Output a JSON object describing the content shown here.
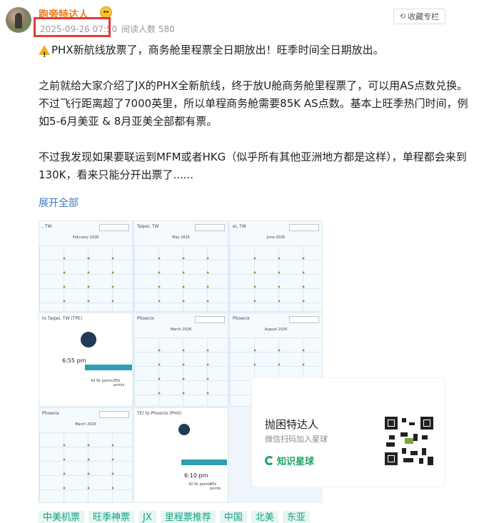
{
  "header": {
    "author": "跑旁特达人",
    "date": "2025-09-26 07:50",
    "views_label": "阅读人数",
    "views": "580",
    "collect_label": "收藏专栏"
  },
  "article": {
    "p1": "PHX新航线放票了，商务舱里程票全日期放出！旺季时间全日期放出。",
    "p2": "之前就给大家介绍了JX的PHX全新航线，终于放U舱商务舱里程票了，可以用AS点数兑换。不过飞行距离超了7000英里，所以单程商务舱需要85K AS点数。基本上旺季热门时间，例如5-6月美亚 & 8月亚美全部都有票。",
    "p3": "不过我发现如果要联运到MFM或者HKG（似乎所有其他亚洲地方都是这样），单程都会来到130K，看来只能分开出票了......",
    "expand": "展开全部"
  },
  "collage": {
    "panel1_cap": ", TW",
    "panel1_mon": "February 2026",
    "panel2_cap": "Taipei, TW",
    "panel2_mon": "May 2026",
    "panel3_cap": "ei, TW",
    "panel3_mon": "June 2026",
    "panel4_cap": "to Taipei, TW (TPE)",
    "panel5_cap": "Phoenix",
    "panel5_mon": "March 2026",
    "panel6_cap": "Phoenix",
    "panel6_mon": "August 2026",
    "panel7_cap": "Phoenix",
    "panel7_mon": "March 2026",
    "panel8_cap": "TE) to Phoenix (PHX)",
    "price_a": "42.5k points",
    "price_b": "85k points",
    "time_a": "6:55 pm",
    "time_b": "6:10 pm"
  },
  "qr_card": {
    "title": "抛困特达人",
    "subtitle": "微信扫码加入星球",
    "brand": "知识星球"
  },
  "tags": [
    "中美机票",
    "旺季神票",
    "JX",
    "里程票推荐",
    "中国",
    "北美",
    "东亚"
  ]
}
